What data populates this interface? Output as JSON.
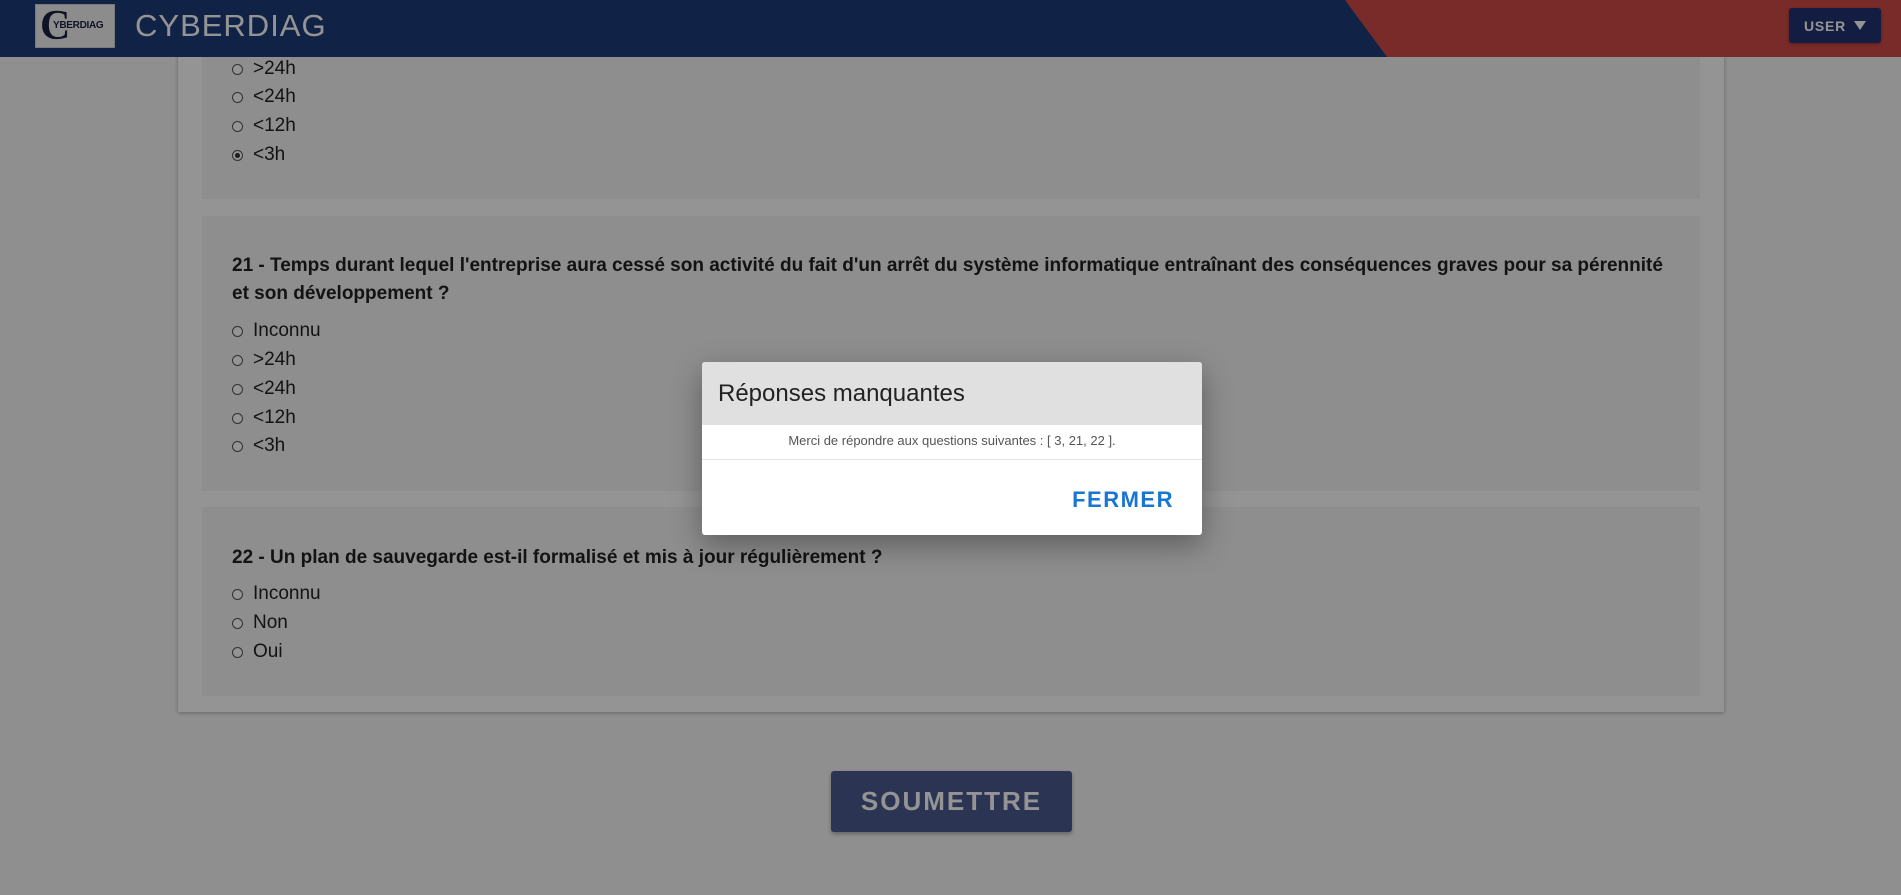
{
  "app": {
    "brand": "CYBERDIAG",
    "logo_text": "YBERDIAG",
    "logo_letter": "C",
    "user_label": "USER"
  },
  "questions": {
    "q20": {
      "options": [
        {
          "label": ">24h",
          "checked": false
        },
        {
          "label": "<24h",
          "checked": false
        },
        {
          "label": "<12h",
          "checked": false
        },
        {
          "label": "<3h",
          "checked": true
        }
      ]
    },
    "q21": {
      "title": "21 - Temps durant lequel l'entreprise aura cessé son activité du fait d'un arrêt du système informatique entraînant des conséquences graves pour sa pérennité et son développement ?",
      "options": [
        {
          "label": "Inconnu",
          "checked": false
        },
        {
          "label": ">24h",
          "checked": false
        },
        {
          "label": "<24h",
          "checked": false
        },
        {
          "label": "<12h",
          "checked": false
        },
        {
          "label": "<3h",
          "checked": false
        }
      ]
    },
    "q22": {
      "title": "22 - Un plan de sauvegarde est-il formalisé et mis à jour régulièrement ?",
      "options": [
        {
          "label": "Inconnu",
          "checked": false
        },
        {
          "label": "Non",
          "checked": false
        },
        {
          "label": "Oui",
          "checked": false
        }
      ]
    }
  },
  "submit_label": "SOUMETTRE",
  "dialog": {
    "title": "Réponses manquantes",
    "message": "Merci de répondre aux questions suivantes : [ 3, 21, 22 ].",
    "close_label": "FERMER"
  },
  "colors": {
    "appbar_blue": "#1e3c7a",
    "appbar_red": "#cf4b48",
    "dialog_action": "#1976d2",
    "submit_button": "#4a5a8f"
  }
}
